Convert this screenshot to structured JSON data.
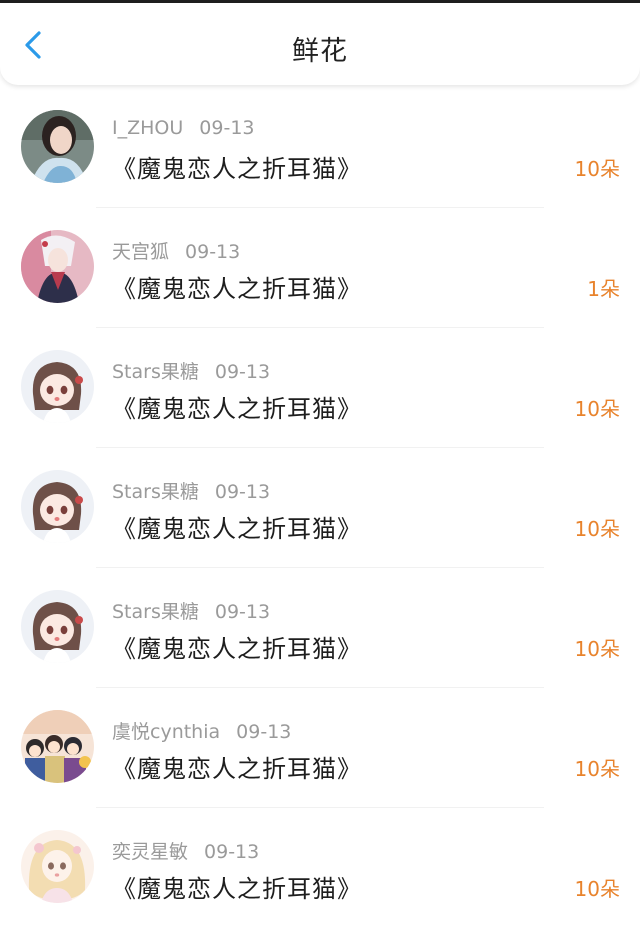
{
  "header": {
    "title": "鲜花",
    "back_icon": "chevron-left-icon",
    "accent_color": "#2b9ae9"
  },
  "count_color": "#e8832c",
  "rows": [
    {
      "user": "I_ZHOU",
      "date": "09-13",
      "book": "《魔鬼恋人之折耳猫》",
      "count": "10朵",
      "avatar": "avatar-photo"
    },
    {
      "user": "天宫狐",
      "date": "09-13",
      "book": "《魔鬼恋人之折耳猫》",
      "count": "1朵",
      "avatar": "avatar-anime-fox"
    },
    {
      "user": "Stars果糖",
      "date": "09-13",
      "book": "《魔鬼恋人之折耳猫》",
      "count": "10朵",
      "avatar": "avatar-chibi-girl"
    },
    {
      "user": "Stars果糖",
      "date": "09-13",
      "book": "《魔鬼恋人之折耳猫》",
      "count": "10朵",
      "avatar": "avatar-chibi-girl"
    },
    {
      "user": "Stars果糖",
      "date": "09-13",
      "book": "《魔鬼恋人之折耳猫》",
      "count": "10朵",
      "avatar": "avatar-chibi-girl"
    },
    {
      "user": "虞悦cynthia",
      "date": "09-13",
      "book": "《魔鬼恋人之折耳猫》",
      "count": "10朵",
      "avatar": "avatar-group-cartoon"
    },
    {
      "user": "奕灵星敏",
      "date": "09-13",
      "book": "《魔鬼恋人之折耳猫》",
      "count": "10朵",
      "avatar": "avatar-blonde-doll"
    }
  ]
}
